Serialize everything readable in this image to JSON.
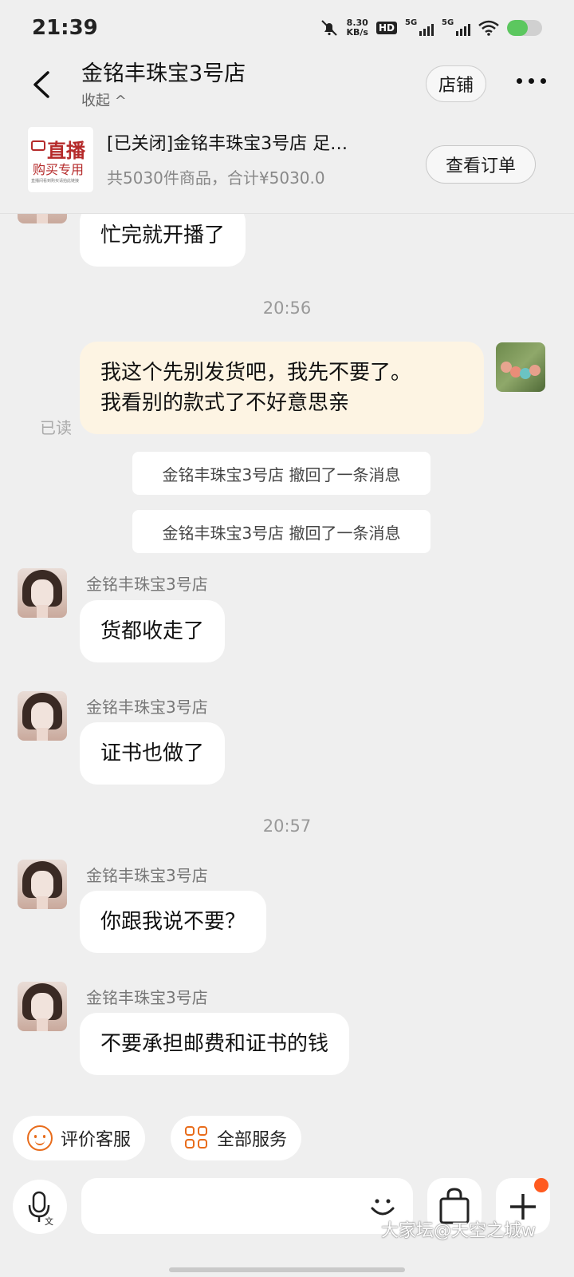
{
  "status_bar": {
    "time": "21:39",
    "net_speed_value": "8.30",
    "net_speed_unit": "KB/s",
    "hd_label": "HD",
    "sim1_label": "5G",
    "sim2_label": "5G",
    "battery_level": 0.6,
    "battery_color": "#5cc75f"
  },
  "header": {
    "title": "金铭丰珠宝3号店",
    "collapse_label": "收起 ^",
    "shop_button": "店铺"
  },
  "order": {
    "thumb_line1": "直播",
    "thumb_line2": "购买专用",
    "thumb_line3": "直播间看到购买请拍此链接",
    "title": "[已关闭]金铭丰珠宝3号店 足…",
    "summary": "共5030件商品，合计¥5030.0",
    "view_order_button": "查看订单"
  },
  "chat": {
    "messages": [
      {
        "text": "忙完就开播了"
      },
      {
        "timestamp": "20:56"
      },
      {
        "text": "我这个先别发货吧，我先不要了。",
        "text2": "我看别的款式了不好意思亲",
        "read_status": "已读"
      },
      {
        "recall": "金铭丰珠宝3号店 撤回了一条消息"
      },
      {
        "recall": "金铭丰珠宝3号店 撤回了一条消息"
      },
      {
        "sender": "金铭丰珠宝3号店",
        "text": "货都收走了"
      },
      {
        "sender": "金铭丰珠宝3号店",
        "text": "证书也做了"
      },
      {
        "timestamp": "20:57"
      },
      {
        "sender": "金铭丰珠宝3号店",
        "text": "你跟我说不要？"
      },
      {
        "sender": "金铭丰珠宝3号店",
        "text": "不要承担邮费和证书的钱"
      }
    ]
  },
  "quick_actions": {
    "rate_service": "评价客服",
    "all_services": "全部服务"
  },
  "accent_color": "#e86c1b",
  "watermark": "大家坛@天空之城w"
}
